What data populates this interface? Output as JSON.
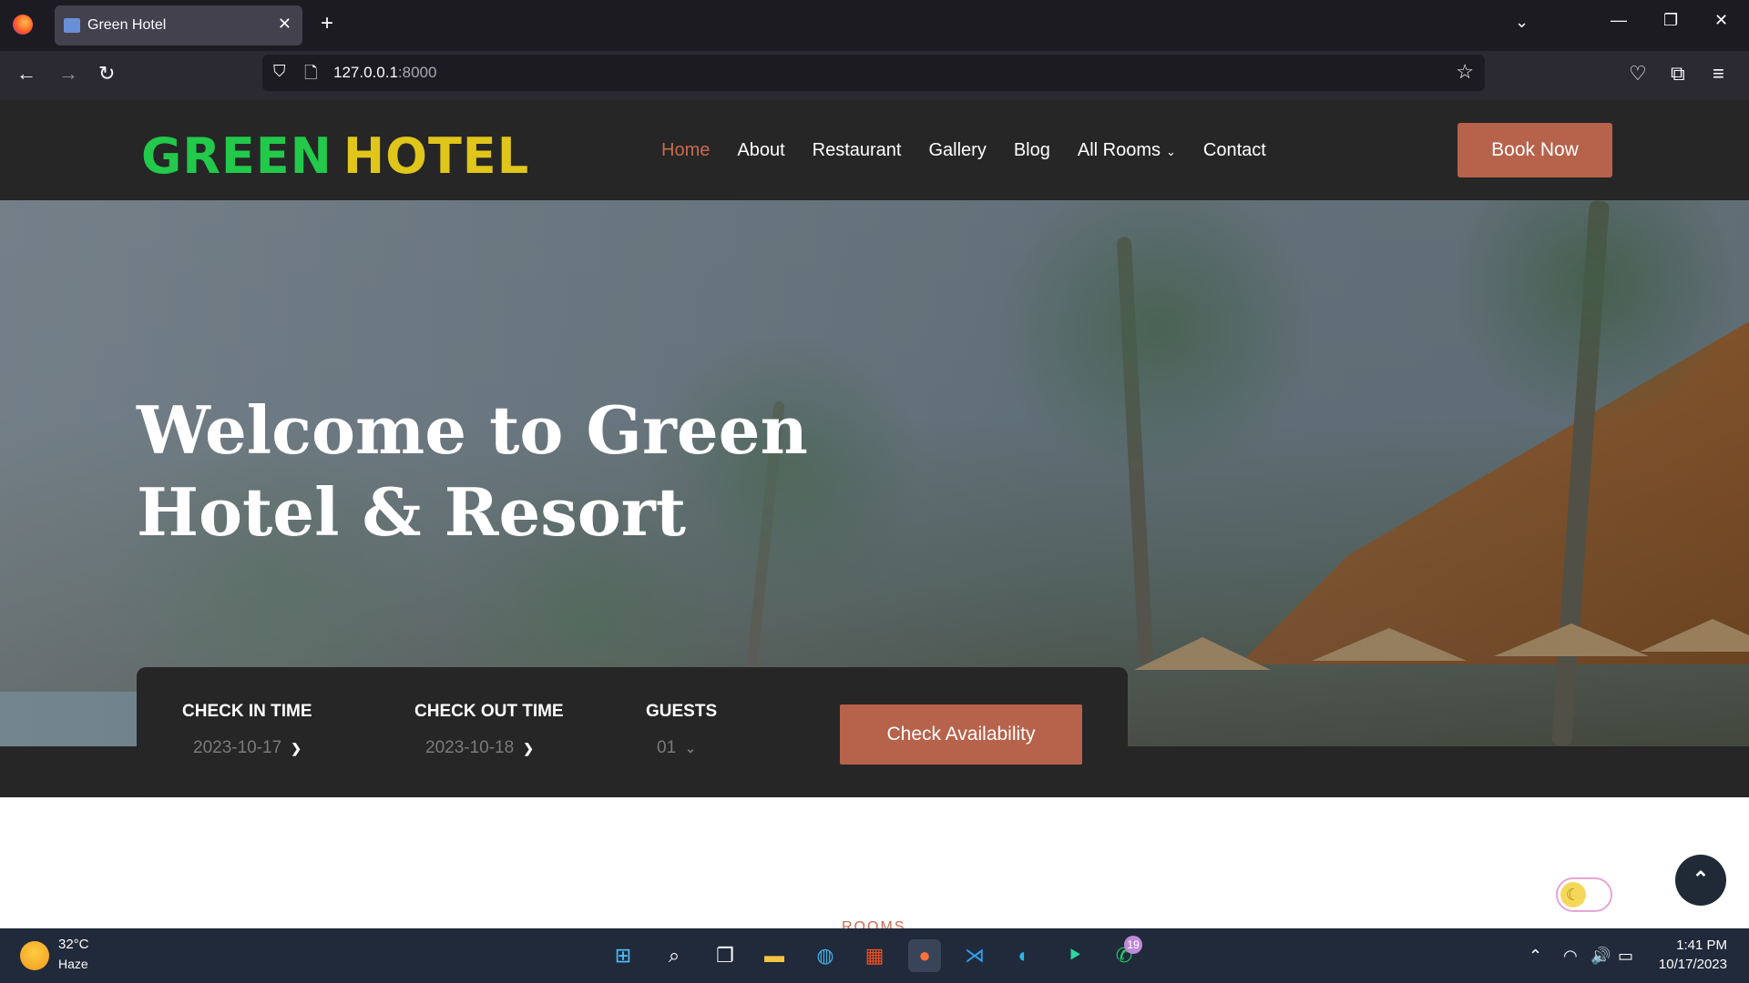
{
  "browser": {
    "tab_title": "Green Hotel",
    "url_host": "127.0.0.1",
    "url_port": ":8000"
  },
  "site": {
    "logo_green": "GREEN",
    "logo_yellow": "HOTEL",
    "menu": [
      {
        "label": "Home"
      },
      {
        "label": "About"
      },
      {
        "label": "Restaurant"
      },
      {
        "label": "Gallery"
      },
      {
        "label": "Blog"
      },
      {
        "label": "All Rooms"
      },
      {
        "label": "Contact"
      }
    ],
    "book_now": "Book Now",
    "hero_title_line1": "Welcome to Green",
    "hero_title_line2": "Hotel & Resort",
    "booking": {
      "checkin_label": "CHECK IN TIME",
      "checkin_value": "2023-10-17",
      "checkout_label": "CHECK OUT TIME",
      "checkout_value": "2023-10-18",
      "guests_label": "GUESTS",
      "guests_value": "01",
      "button": "Check Availability"
    },
    "rooms_peek": "ROOMS"
  },
  "taskbar": {
    "weather_temp": "32°C",
    "weather_desc": "Haze",
    "whatsapp_badge": "19",
    "time": "1:41 PM",
    "date": "10/17/2023"
  },
  "colors": {
    "accent": "#b7624a",
    "logo_green": "#22c94a",
    "logo_yellow": "#e0c51a",
    "header_bg": "#262626"
  }
}
